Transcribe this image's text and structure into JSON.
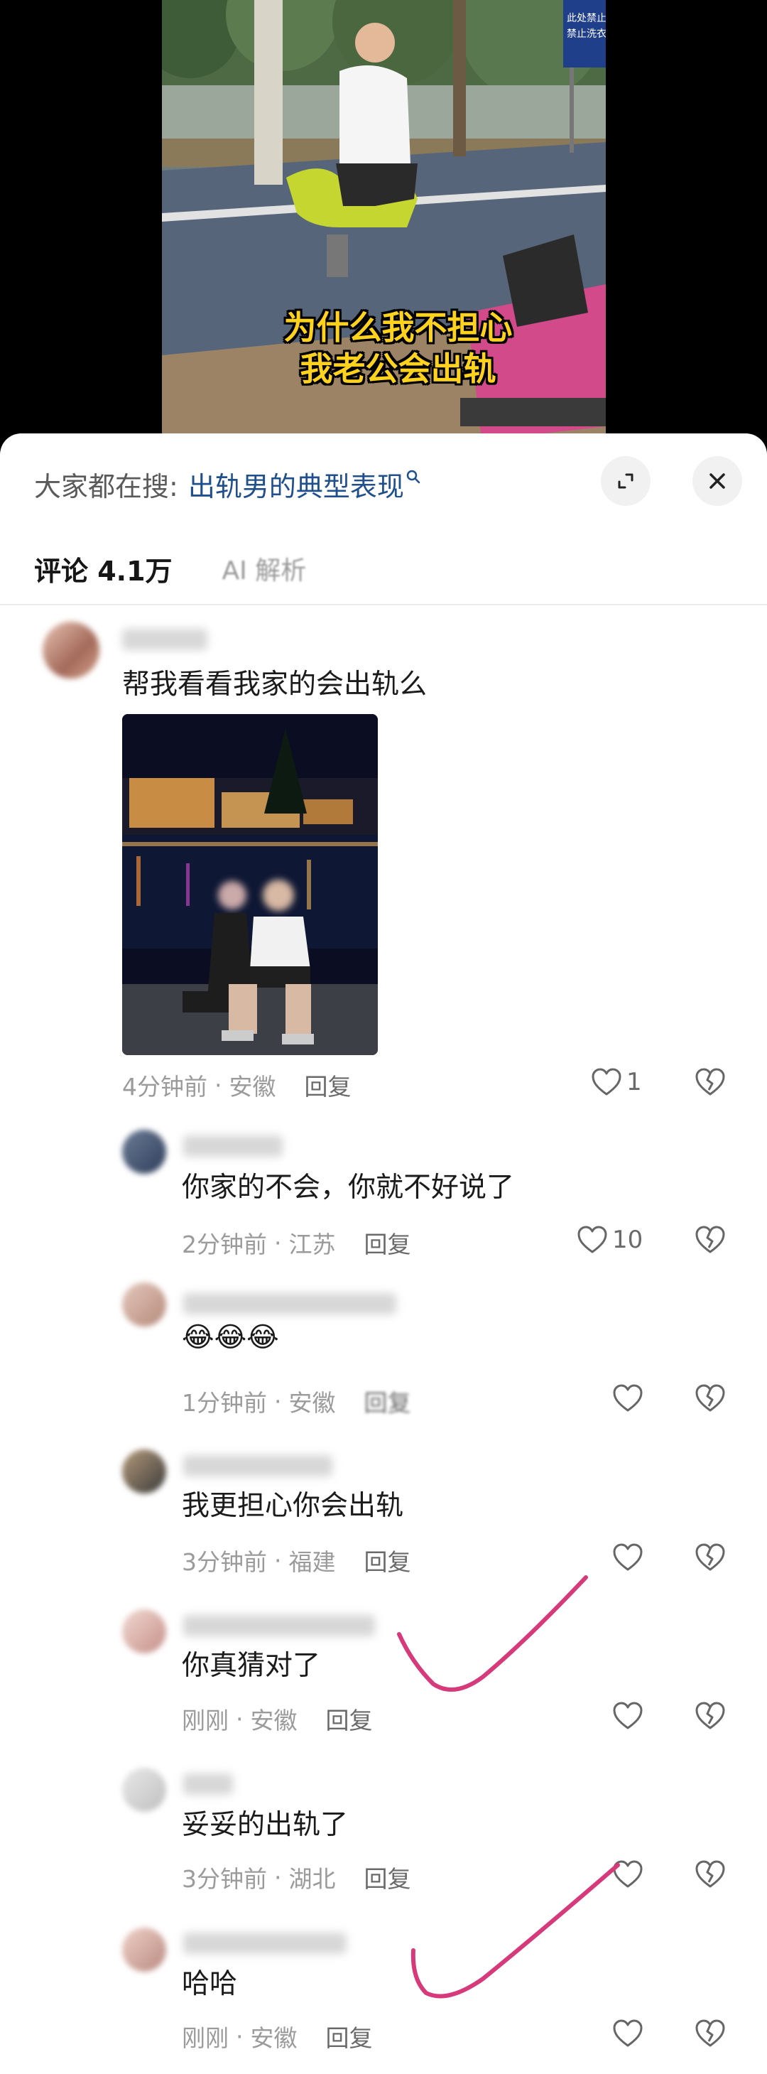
{
  "video": {
    "caption_line1": "为什么我不担心",
    "caption_line2": "我老公会出轨",
    "sign_line1": "此处禁止",
    "sign_line2": "禁止洗衣"
  },
  "search": {
    "prefix": "大家都在搜:",
    "term": "出轨男的典型表现"
  },
  "tabs": {
    "comments": "评论 4.1万",
    "ai": "AI 解析"
  },
  "comments": [
    {
      "text": "帮我看看我家的会出轨么",
      "time": "4分钟前",
      "location": "安徽",
      "reply": "回复",
      "likes": "1"
    },
    {
      "text": "你家的不会，你就不好说了",
      "time": "2分钟前",
      "location": "江苏",
      "reply": "回复",
      "likes": "10"
    },
    {
      "text": "😂😂😂",
      "time": "1分钟前",
      "location": "安徽",
      "reply": "回复",
      "likes": ""
    },
    {
      "text": "我更担心你会出轨",
      "time": "3分钟前",
      "location": "福建",
      "reply": "回复",
      "likes": ""
    },
    {
      "text": "你真猜对了",
      "time": "刚刚",
      "location": "安徽",
      "reply": "回复",
      "likes": ""
    },
    {
      "text": "妥妥的出轨了",
      "time": "3分钟前",
      "location": "湖北",
      "reply": "回复",
      "likes": ""
    },
    {
      "text": "哈哈",
      "time": "刚刚",
      "location": "安徽",
      "reply": "回复",
      "likes": ""
    }
  ],
  "icons": {
    "search": "search-icon",
    "expand": "expand-icon",
    "close": "close-icon",
    "like": "heart-icon",
    "dislike": "broken-heart-icon"
  },
  "colors": {
    "search_term": "#1f4f8c",
    "annotation": "#d63a7a",
    "caption": "#ffd21e"
  }
}
